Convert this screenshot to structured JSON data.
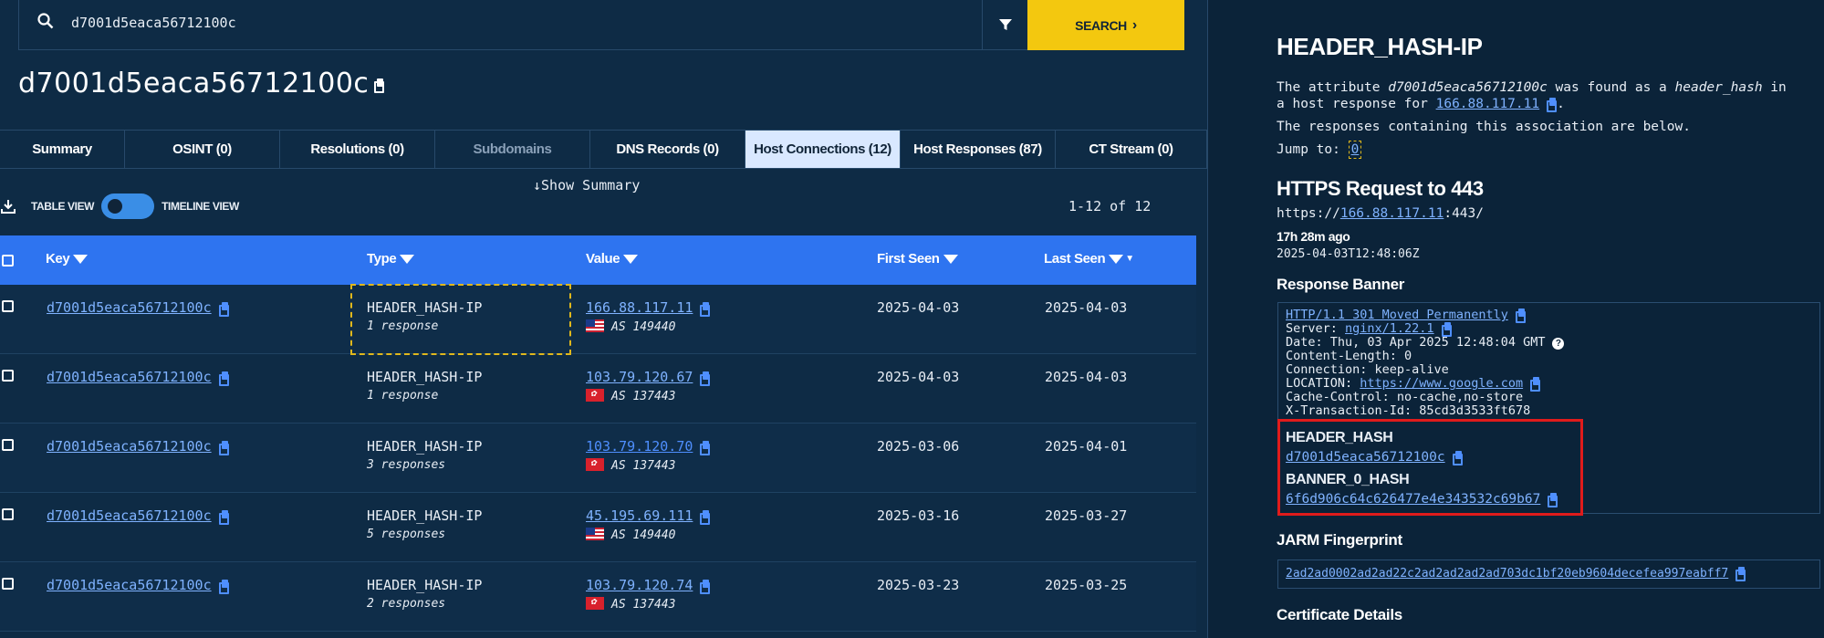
{
  "search": {
    "value": "d7001d5eaca56712100c",
    "button_label": "SEARCH"
  },
  "page_title": "d7001d5eaca56712100c",
  "tabs": [
    {
      "label": "Summary"
    },
    {
      "label": "OSINT (0)"
    },
    {
      "label": "Resolutions (0)"
    },
    {
      "label": "Subdomains"
    },
    {
      "label": "DNS Records (0)"
    },
    {
      "label": "Host Connections (12)"
    },
    {
      "label": "Host Responses (87)"
    },
    {
      "label": "CT Stream (0)"
    }
  ],
  "show_summary": "Show Summary",
  "toolbar": {
    "table_view": "TABLE VIEW",
    "timeline_view": "TIMELINE VIEW",
    "count": "1-12 of 12"
  },
  "table": {
    "headers": {
      "key": "Key",
      "type": "Type",
      "value": "Value",
      "first_seen": "First Seen",
      "last_seen": "Last Seen"
    },
    "rows": [
      {
        "key": "d7001d5eaca56712100c",
        "type": "HEADER_HASH-IP",
        "responses": "1 response",
        "value": "166.88.117.11",
        "as": "AS 149440",
        "flag": "my",
        "first_seen": "2025-04-03",
        "last_seen": "2025-04-03"
      },
      {
        "key": "d7001d5eaca56712100c",
        "type": "HEADER_HASH-IP",
        "responses": "1 response",
        "value": "103.79.120.67",
        "as": "AS 137443",
        "flag": "hk",
        "first_seen": "2025-04-03",
        "last_seen": "2025-04-03"
      },
      {
        "key": "d7001d5eaca56712100c",
        "type": "HEADER_HASH-IP",
        "responses": "3 responses",
        "value": "103.79.120.70",
        "as": "AS 137443",
        "flag": "hk",
        "first_seen": "2025-03-06",
        "last_seen": "2025-04-01"
      },
      {
        "key": "d7001d5eaca56712100c",
        "type": "HEADER_HASH-IP",
        "responses": "5 responses",
        "value": "45.195.69.111",
        "as": "AS 149440",
        "flag": "my",
        "first_seen": "2025-03-16",
        "last_seen": "2025-03-27"
      },
      {
        "key": "d7001d5eaca56712100c",
        "type": "HEADER_HASH-IP",
        "responses": "2 responses",
        "value": "103.79.120.74",
        "as": "AS 137443",
        "flag": "hk",
        "first_seen": "2025-03-23",
        "last_seen": "2025-03-25"
      }
    ]
  },
  "panel": {
    "title": "HEADER_HASH-IP",
    "desc_1": "The attribute ",
    "desc_attr": "d7001d5eaca56712100c",
    "desc_2": " was found as a ",
    "desc_kind": "header_hash",
    "desc_3": " in",
    "desc_4": "a host response for ",
    "desc_ip": "166.88.117.11",
    "desc_5": ".",
    "desc_6": "The responses containing this association are below.",
    "jump_to": "Jump to: ",
    "jump_value": "0",
    "https_title": "HTTPS Request to 443",
    "https_prefix": "https://",
    "https_ip": "166.88.117.11",
    "https_suffix": ":443/",
    "ago": "17h 28m ago",
    "timestamp": "2025-04-03T12:48:06Z",
    "banner_title": "Response Banner",
    "banner": {
      "status": "HTTP/1.1 301 Moved Permanently",
      "server_label": "Server: ",
      "server_value": "nginx/1.22.1",
      "date": "Date: Thu, 03 Apr 2025 12:48:04 GMT",
      "content_length": "Content-Length: 0",
      "connection": "Connection: keep-alive",
      "location_label": "LOCATION: ",
      "location_value": "https://www.google.com",
      "cache_control": "Cache-Control: no-cache,no-store",
      "transaction": "X-Transaction-Id: 85cd3d3533ft678"
    },
    "header_hash_label": "HEADER_HASH",
    "header_hash_value": "d7001d5eaca56712100c",
    "banner_hash_label": "BANNER_0_HASH",
    "banner_hash_value": "6f6d906c64c626477e4e343532c69b67",
    "jarm_title": "JARM Fingerprint",
    "jarm_value": "2ad2ad0002ad2ad22c2ad2ad2ad2ad703dc1bf20eb9604decefea997eabff7",
    "cert_title": "Certificate Details"
  },
  "colors": {
    "accent_blue": "#2e74f0",
    "search_yellow": "#f3c80f",
    "highlight_red": "#e01b1b",
    "bg": "#0e2b45"
  }
}
